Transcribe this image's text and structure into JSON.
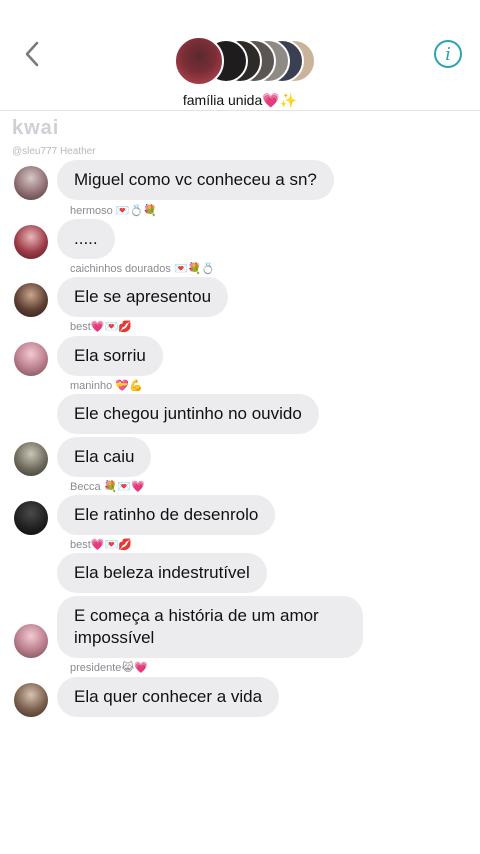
{
  "header": {
    "group_name": "família unida💗✨",
    "back_icon": "chevron-left-icon",
    "info_icon": "info-icon",
    "info_symbol": "i",
    "accent_color": "#2aa3b3"
  },
  "watermark": {
    "brand": "kwai",
    "handle": "@sleu777 Heather"
  },
  "messages": [
    {
      "sender": "",
      "text": "Miguel como vc conheceu a sn?"
    },
    {
      "sender": "hermoso 💌💍💐",
      "text": "....."
    },
    {
      "sender": "caichinhos dourados 💌💐💍",
      "text": "Ele se apresentou"
    },
    {
      "sender": "best💗💌💋",
      "text": "Ela sorriu"
    },
    {
      "sender": "maninho 💝💪",
      "text": "Ele chegou juntinho no ouvido"
    },
    {
      "sender": "",
      "text": "Ela caiu"
    },
    {
      "sender": "Becca 💐💌💗",
      "text": "Ele ratinho de desenrolo"
    },
    {
      "sender": "best💗💌💋",
      "text": "Ela beleza indestrutível"
    },
    {
      "sender": "",
      "text": "E começa a história de um amor impossível"
    },
    {
      "sender": "presidente😹💗",
      "text": "Ela quer conhecer a vida"
    }
  ]
}
